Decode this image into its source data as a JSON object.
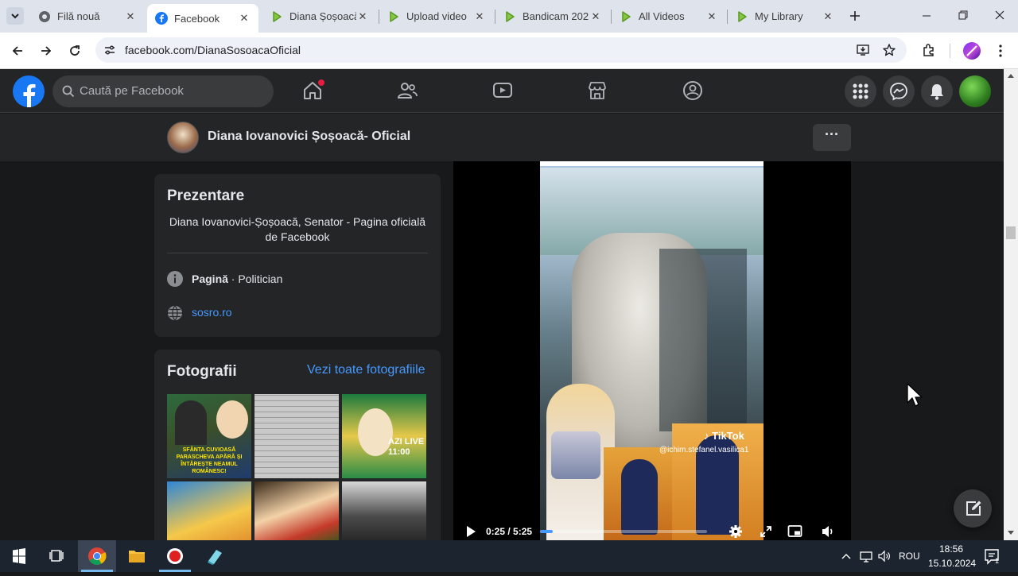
{
  "browser": {
    "tabs": [
      {
        "label": "Filă nouă",
        "icon": "chrome-icon"
      },
      {
        "label": "Facebook",
        "icon": "facebook-icon",
        "active": true
      },
      {
        "label": "Diana Șoșoacă",
        "icon": "rumble-icon"
      },
      {
        "label": "Upload video",
        "icon": "rumble-icon"
      },
      {
        "label": "Bandicam 202",
        "icon": "rumble-icon"
      },
      {
        "label": "All Videos",
        "icon": "rumble-icon"
      },
      {
        "label": "My Library",
        "icon": "rumble-icon"
      }
    ],
    "url": "facebook.com/DianaSosoacaOficial"
  },
  "facebook": {
    "search_placeholder": "Caută pe Facebook",
    "page_name": "Diana Iovanovici Șoșoacă- Oficial",
    "more_label": "···"
  },
  "intro": {
    "title": "Prezentare",
    "description": "Diana Iovanovici-Șoșoacă, Senator - Pagina oficială de Facebook",
    "category_bold": "Pagină",
    "category_rest": " · Politician",
    "website": "sosro.ro"
  },
  "photos": {
    "title": "Fotografii",
    "see_all": "Vezi toate fotografiile",
    "thumb_texts": [
      "SFÂNTA CUVIOASĂ PARASCHEVA APĂRĂ ȘI ÎNTĂREȘTE NEAMUL ROMÂNESC!",
      "",
      "AZI LIVE 11:00",
      "",
      "",
      ""
    ]
  },
  "video": {
    "time": "0:25 / 5:25",
    "watermark": "TikTok",
    "handle": "@ichim.stefanel.vasilica1",
    "progress": 0.077
  },
  "taskbar": {
    "language": "ROU",
    "time": "18:56",
    "date": "15.10.2024",
    "notif_count": "1"
  },
  "colors": {
    "fb_blue": "#1877f2",
    "link_blue": "#4599ff",
    "dark_card": "#242526",
    "bg": "#18191a"
  }
}
